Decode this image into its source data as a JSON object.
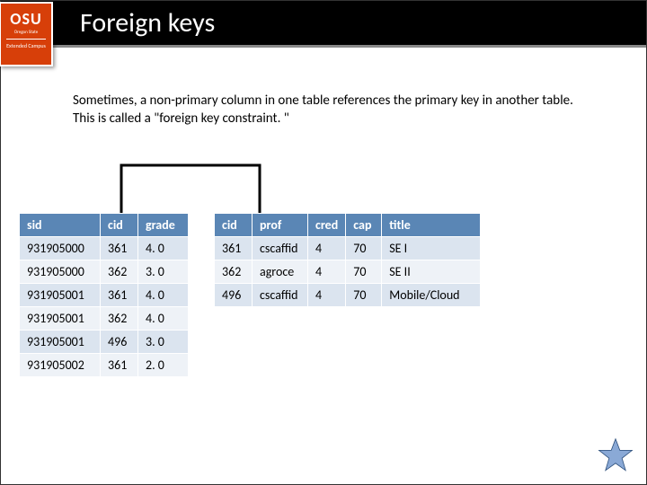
{
  "header": {
    "logo_top": "OSU",
    "logo_mid": "Oregon State",
    "logo_bot": "Extended Campus",
    "title": "Foreign keys"
  },
  "intro": "Sometimes, a non-primary column in one table references the primary key in another table. This is called a \"foreign key constraint. \"",
  "table1": {
    "headers": [
      "sid",
      "cid",
      "grade"
    ],
    "rows": [
      [
        "931905000",
        "361",
        "4. 0"
      ],
      [
        "931905000",
        "362",
        "3. 0"
      ],
      [
        "931905001",
        "361",
        "4. 0"
      ],
      [
        "931905001",
        "362",
        "4. 0"
      ],
      [
        "931905001",
        "496",
        "3. 0"
      ],
      [
        "931905002",
        "361",
        "2. 0"
      ]
    ]
  },
  "table2": {
    "headers": [
      "cid",
      "prof",
      "cred",
      "cap",
      "title"
    ],
    "rows": [
      [
        "361",
        "cscaffid",
        "4",
        "70",
        "SE I"
      ],
      [
        "362",
        "agroce",
        "4",
        "70",
        "SE II"
      ],
      [
        "496",
        "cscaffid",
        "4",
        "70",
        "Mobile/Cloud"
      ]
    ]
  }
}
